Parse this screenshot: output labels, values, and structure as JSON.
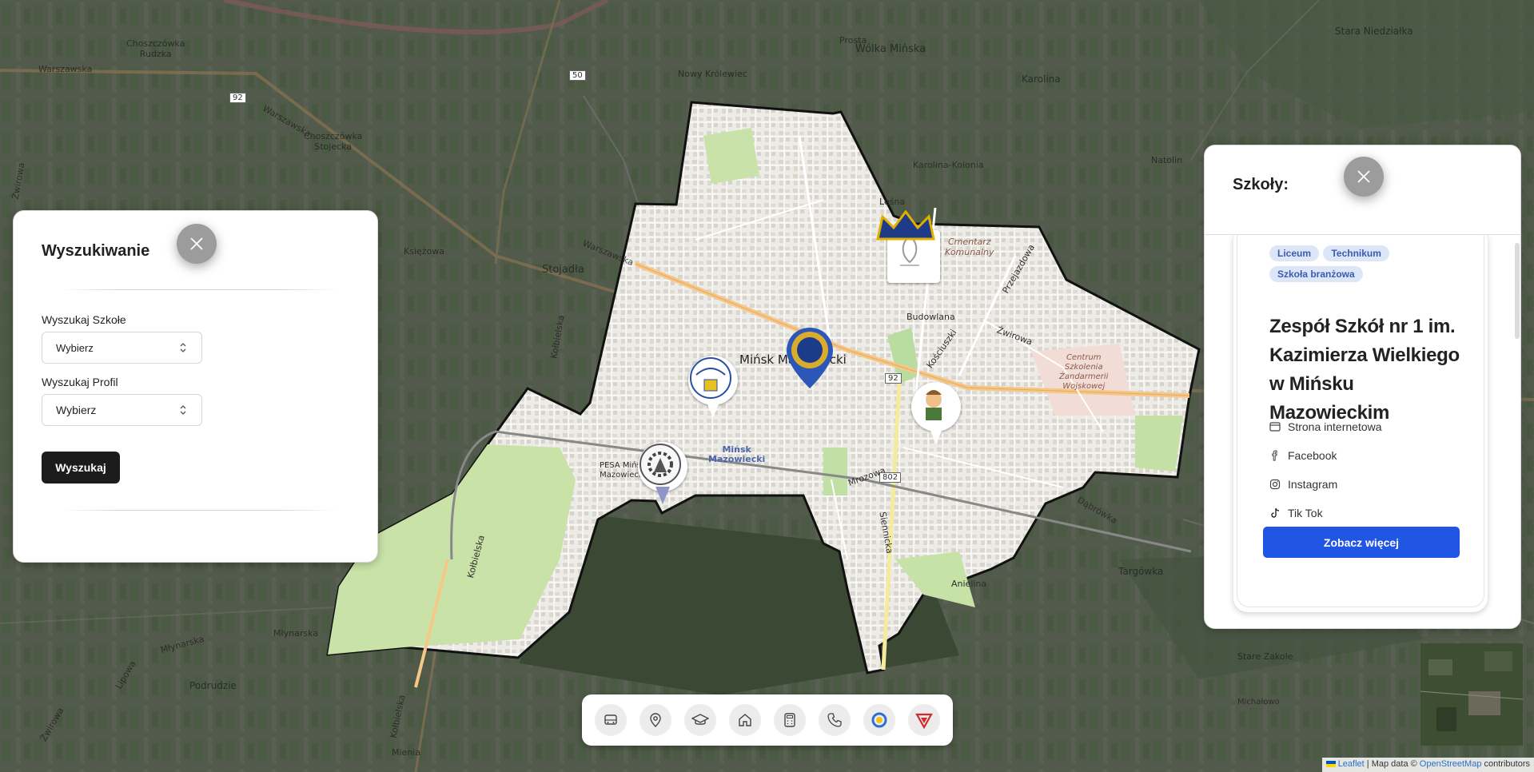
{
  "map": {
    "labels": {
      "choszczowka_rudzka": "Choszczówka\nRudzka",
      "warszawska1": "Warszawska",
      "warszawska2": "Warszawska",
      "warszawska3": "Warszawska",
      "choszczowka_stojecka": "Choszczówka\nStojecka",
      "ksiezowa": "Księżowa",
      "stojadla": "Stojadła",
      "nowy_krolewiec": "Nowy Królewiec",
      "prosta": "Prosta",
      "wolka_minska": "Wólka Mińska",
      "karolina": "Karolina",
      "stara_niedzialka": "Stara Niedziałka",
      "natolin": "Natolin",
      "karolina_kolonia": "Karolina-Kolonia",
      "lesna": "Leśna",
      "cmentarz": "Cmentarz\nKomunalny",
      "budowlana": "Budowlana",
      "minsk_city": "Mińsk Mazowiecki",
      "minsk_station": "Mińsk\nMazowiecki",
      "pesa": "PESA Mińsk\nMazowiecki",
      "centrum": "Centrum\nSzkolenia\nŻandarmerii\nWojskowej",
      "kosciuszki": "Kościuszki",
      "mrozowa": "Mrozowa",
      "siennicka": "Siennicka",
      "targowka": "Targówka",
      "anielina": "Anielina",
      "dabrowka": "Dąbrówka",
      "stare_zakole": "Stare Zakole",
      "michalowo": "Michałowo",
      "podrudzie": "Podrudzie",
      "mlynarska1": "Młynarska",
      "mlynarska2": "Młynarska",
      "kolbielska1": "Kołbielska",
      "kolbielska2": "Kołbielska",
      "kolbielska3": "Kołbielska",
      "mieni": "Mienia",
      "przejazdowa": "Przejazdowa",
      "zwirowa1": "Żwirowa",
      "zwirowa2": "Żwirowa",
      "zwirowa3": "Żwirowa",
      "lipowa": "Lipowa"
    },
    "road_shields": [
      "92",
      "92",
      "50",
      "802"
    ]
  },
  "search_panel": {
    "title": "Wyszukiwanie",
    "school_label": "Wyszukaj Szkołe",
    "school_value": "Wybierz",
    "profile_label": "Wyszukaj Profil",
    "profile_value": "Wybierz",
    "search_button": "Wyszukaj"
  },
  "schools_panel": {
    "title": "Szkoły:",
    "card": {
      "badges": [
        "Liceum",
        "Technikum",
        "Szkoła branżowa"
      ],
      "name": "Zespół Szkół nr 1 im. Kazimierza Wielkiego w Mińsku Mazowieckim",
      "links": [
        "Strona internetowa",
        "Facebook",
        "Instagram",
        "Tik Tok"
      ],
      "more_button": "Zobacz więcej"
    }
  },
  "toolbar": {
    "icons": [
      "bus-icon",
      "map-pin-icon",
      "graduation-cap-icon",
      "home-icon",
      "calculator-icon",
      "phone-icon",
      "circle-logo-icon",
      "shield-logo-icon"
    ]
  },
  "attribution": {
    "leaflet": "Leaflet",
    "text": "| Map data ©",
    "osm": "OpenStreetMap",
    "suffix": "contributors"
  },
  "colors": {
    "accent_blue": "#2156e4",
    "badge_bg": "#dde6f7",
    "badge_text": "#3a5bb0",
    "dark_button": "#1c1c1c",
    "overlay": "#4a4f47"
  }
}
